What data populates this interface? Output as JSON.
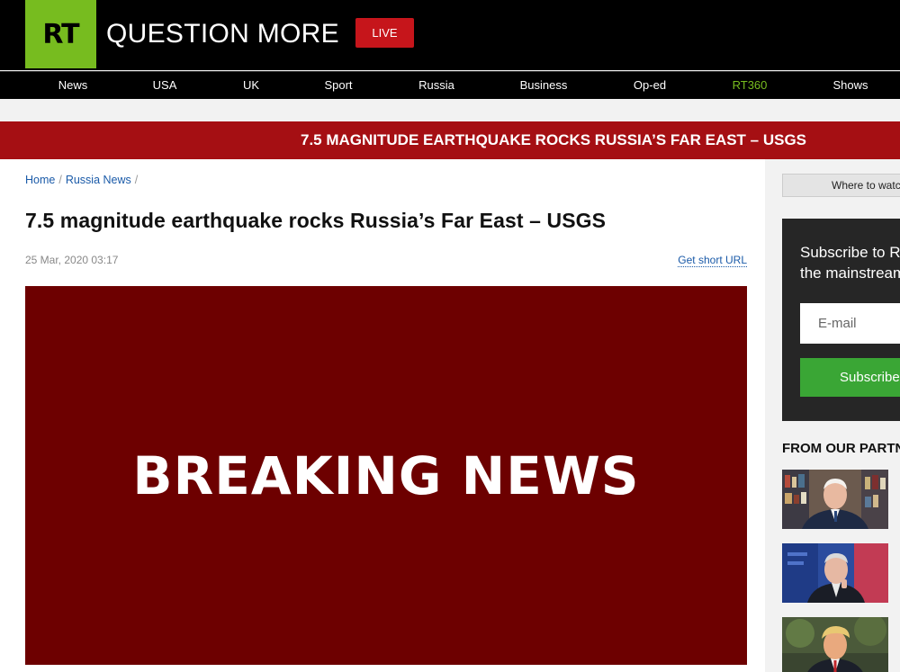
{
  "header": {
    "logo_text": "RT",
    "slogan": "QUESTION MORE",
    "live_label": "LIVE"
  },
  "nav": {
    "items": [
      "News",
      "USA",
      "UK",
      "Sport",
      "Russia",
      "Business",
      "Op-ed",
      "RT360",
      "Shows"
    ]
  },
  "banner": {
    "text": "7.5 MAGNITUDE EARTHQUAKE ROCKS RUSSIA’S FAR EAST – USGS"
  },
  "breadcrumb": {
    "home": "Home",
    "section": "Russia News",
    "separator": "/"
  },
  "article": {
    "title": "7.5 magnitude earthquake rocks Russia’s Far East – USGS",
    "date": "25 Mar, 2020 03:17",
    "short_url_label": "Get short URL",
    "image_text": "BREAKING NEWS"
  },
  "sidebar": {
    "watch_label": "Where to watch",
    "subscribe_line1": "Subscribe to RT",
    "subscribe_line2": "the mainstream",
    "email_placeholder": "E-mail",
    "subscribe_button": "Subscribe",
    "partners_heading": "FROM OUR PARTNERS"
  },
  "colors": {
    "brand_green": "#77bc1f",
    "live_red": "#c6151b",
    "banner_red": "#a50f13",
    "breaking_bg": "#6d0000",
    "subscribe_green": "#3aa635",
    "link_blue": "#1a5aa8"
  }
}
